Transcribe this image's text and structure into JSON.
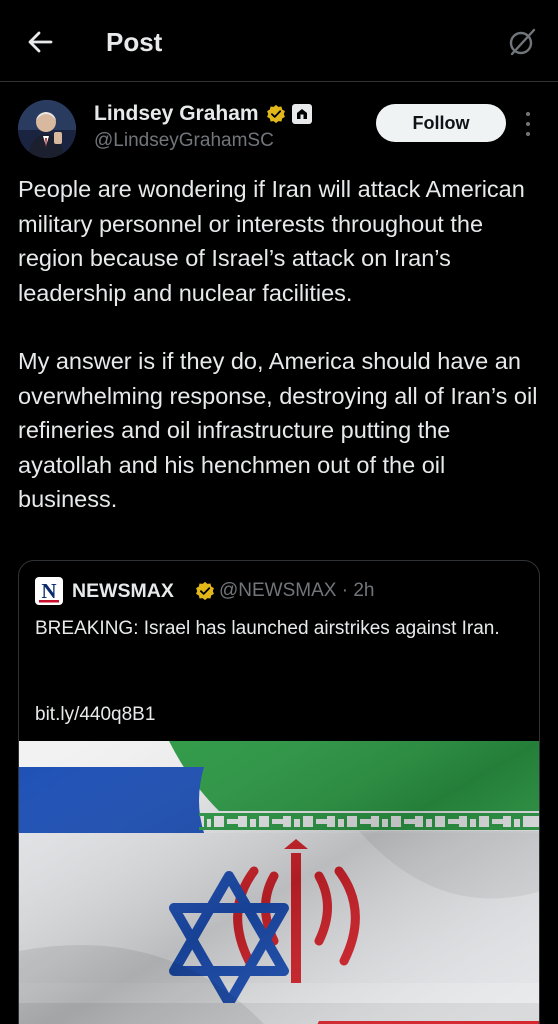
{
  "header": {
    "title": "Post"
  },
  "author": {
    "name": "Lindsey Graham",
    "handle": "@LindseyGrahamSC",
    "follow_label": "Follow"
  },
  "post": {
    "paragraphs": [
      "People are wondering if Iran will attack American military personnel or interests throughout the region because of Israel’s attack on Iran’s leadership and nuclear facilities.",
      "My answer is if they do, America should have an overwhelming response, destroying all of Iran’s oil refineries and oil infrastructure putting the ayatollah and his henchmen out of the oil business."
    ]
  },
  "quote": {
    "logo_letter": "N",
    "name": "NEWSMAX",
    "handle_time": "@NEWSMAX · 2h",
    "text": "BREAKING: Israel has launched airstrikes against Iran.",
    "link": "bit.ly/440q8B1"
  },
  "icons": {
    "back": "arrow-left-icon",
    "grok": "grok-icon",
    "verified": "verified-gold-icon",
    "affiliation": "affiliation-badge-icon"
  },
  "colors": {
    "background": "#000000",
    "text": "#e7e9ea",
    "secondary": "#71767b",
    "border": "#2f3336",
    "verified_gold": "#e2b719",
    "israel_blue": "#1c4fb5",
    "iran_green": "#2c9a45",
    "iran_red": "#d5232b"
  }
}
